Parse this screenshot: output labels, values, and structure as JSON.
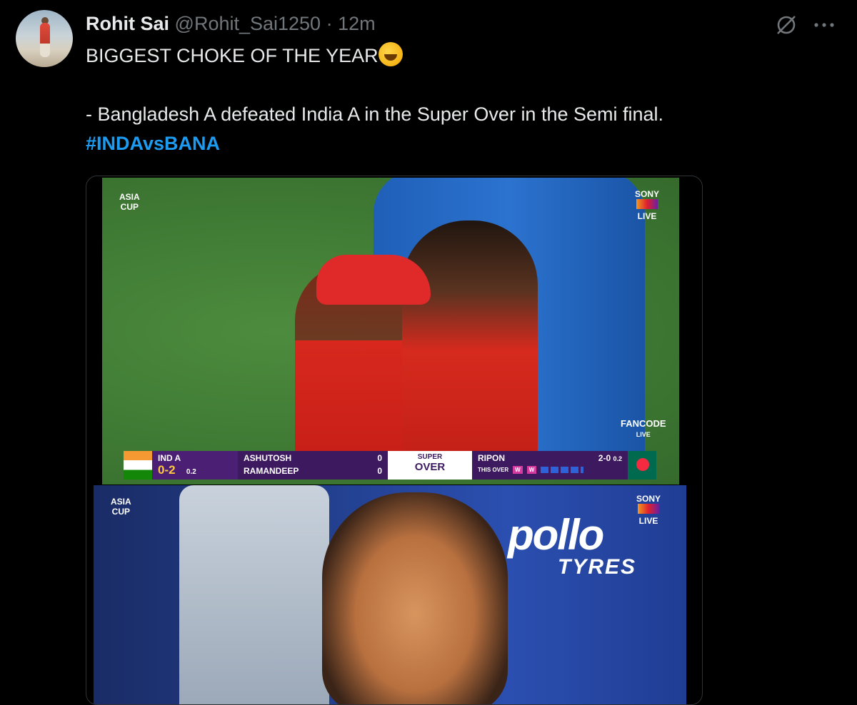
{
  "tweet": {
    "author_name": "Rohit Sai",
    "handle": "@Rohit_Sai1250",
    "separator": "·",
    "timestamp": "12m",
    "line1": "BIGGEST CHOKE OF THE YEAR",
    "line1_emoji": "rolling-on-floor-laughing",
    "line2": "- Bangladesh A defeated India A in the Super Over in the Semi final.",
    "hashtag": "#INDAvsBANA"
  },
  "media": {
    "image1": {
      "channel": "SONY",
      "live_label": "LIVE",
      "fancode": "FANCODE",
      "fancode_sub": "LIVE",
      "scoreboard": {
        "team": "IND A",
        "score": "0-2",
        "overs": "0.2",
        "batter1": "ASHUTOSH",
        "batter1_runs": "0",
        "batter2": "RAMANDEEP",
        "batter2_runs": "0",
        "mode_line1": "SUPER",
        "mode_line2": "OVER",
        "bowler": "RIPON",
        "bowler_figures": "2-0",
        "bowler_overs": "0.2",
        "this_over_label": "THIS OVER",
        "this_over_balls": [
          "W",
          "W"
        ]
      }
    },
    "image2": {
      "channel": "SONY",
      "live_label": "LIVE",
      "sponsor_line1": "pollo",
      "sponsor_line2": "TYRES"
    }
  },
  "colors": {
    "background": "#000000",
    "text": "#e7e9ea",
    "muted": "#71767b",
    "link": "#1d9bf0"
  }
}
